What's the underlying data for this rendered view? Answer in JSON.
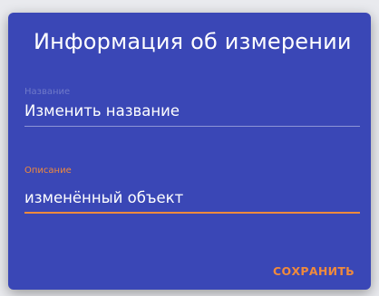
{
  "dialog": {
    "title": "Информация об измерении",
    "name_field": {
      "label": "Название",
      "value": "Изменить название"
    },
    "description_field": {
      "label": "Описание",
      "value": "изменённый объект"
    },
    "save_label": "СОХРАНИТЬ"
  },
  "colors": {
    "background": "#3a47b6",
    "accent": "#f08a3c",
    "text": "#ffffff",
    "inactive_label": "#6f79c9"
  }
}
